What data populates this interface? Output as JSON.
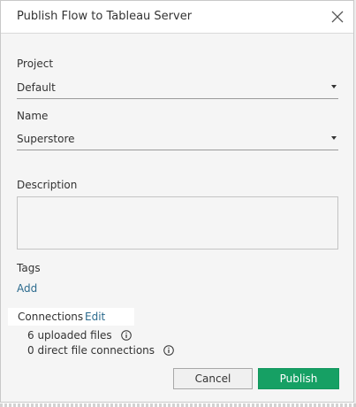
{
  "dialog": {
    "title": "Publish Flow to Tableau Server",
    "close_icon": "close-icon"
  },
  "form": {
    "project": {
      "label": "Project",
      "value": "Default"
    },
    "name": {
      "label": "Name",
      "value": "Superstore"
    },
    "description": {
      "label": "Description",
      "value": ""
    },
    "tags": {
      "label": "Tags",
      "add_link": "Add"
    },
    "connections": {
      "label": "Connections",
      "edit_link": "Edit",
      "uploaded_files": "6 uploaded files",
      "direct_connections": "0 direct file connections"
    }
  },
  "buttons": {
    "cancel_label": "Cancel",
    "publish_label": "Publish"
  },
  "colors": {
    "publish": "#16a064",
    "link": "#2c6b8e",
    "dialog_bg": "#f5f5f5"
  }
}
